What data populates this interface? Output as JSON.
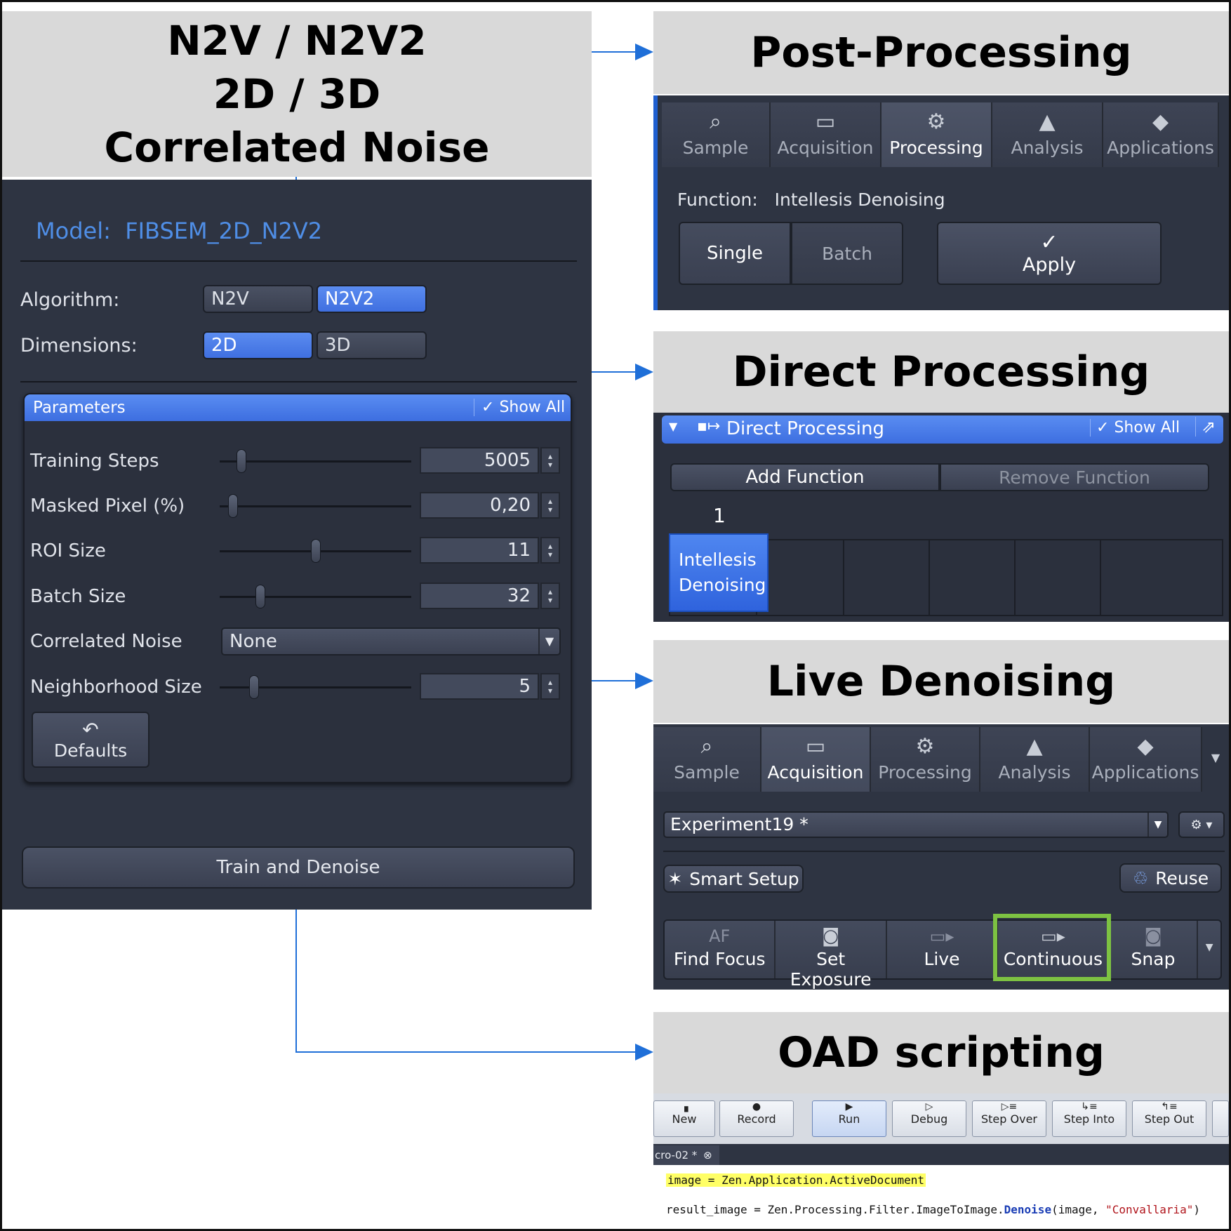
{
  "main_title": {
    "line1": "N2V / N2V2",
    "line2": "2D / 3D",
    "line3": "Correlated Noise"
  },
  "left_panel": {
    "model_label": "Model:",
    "model_value": "FIBSEM_2D_N2V2",
    "algorithm_label": "Algorithm:",
    "algorithm_options": [
      "N2V",
      "N2V2"
    ],
    "algorithm_selected": "N2V2",
    "dimensions_label": "Dimensions:",
    "dimension_options": [
      "2D",
      "3D"
    ],
    "dimension_selected": "2D",
    "parameters_header": "Parameters",
    "show_all": "Show All",
    "params": [
      {
        "label": "Training Steps",
        "value": "5005",
        "slider": 0.1
      },
      {
        "label": "Masked Pixel (%)",
        "value": "0,20",
        "slider": 0.05
      },
      {
        "label": "ROI Size",
        "value": "11",
        "slider": 0.5
      },
      {
        "label": "Batch Size",
        "value": "32",
        "slider": 0.2
      }
    ],
    "correlated_noise_label": "Correlated Noise",
    "correlated_noise_value": "None",
    "neighborhood_label": "Neighborhood Size",
    "neighborhood_value": "5",
    "neighborhood_slider": 0.17,
    "defaults_button": "Defaults",
    "train_button": "Train and Denoise"
  },
  "post_processing": {
    "title": "Post-Processing",
    "tabs": [
      "Sample",
      "Acquisition",
      "Processing",
      "Analysis",
      "Applications"
    ],
    "active_tab": "Processing",
    "function_label": "Function:",
    "function_value": "Intellesis Denoising",
    "single": "Single",
    "batch": "Batch",
    "apply": "Apply"
  },
  "direct_processing": {
    "title": "Direct Processing",
    "header": "Direct Processing",
    "show_all": "Show All",
    "add_function": "Add Function",
    "remove_function": "Remove Function",
    "slot_number": "1",
    "slot_line1": "Intellesis",
    "slot_line2": "Denoising"
  },
  "live_denoising": {
    "title": "Live Denoising",
    "tabs": [
      "Sample",
      "Acquisition",
      "Processing",
      "Analysis",
      "Applications"
    ],
    "active_tab": "Acquisition",
    "experiment": "Experiment19 *",
    "smart_setup": "Smart Setup",
    "reuse": "Reuse",
    "actions": [
      "Find Focus",
      "Set Exposure",
      "Live",
      "Continuous",
      "Snap"
    ],
    "af_label": "AF",
    "highlight_color": "#7dc242"
  },
  "oad_scripting": {
    "title": "OAD scripting",
    "toolbar": [
      "New",
      "Record",
      "Run",
      "Debug",
      "Step Over",
      "Step Into",
      "Step Out"
    ],
    "doc_tab": "cro-02 *",
    "code_line1": "image = Zen.Application.ActiveDocument",
    "code_line2_prefix": "result_image = Zen.Processing.Filter.ImageToImage.",
    "code_line2_method": "Denoise",
    "code_line2_args": "(image, ",
    "code_line2_string": "\"Convallaria\"",
    "code_line2_end": ")"
  },
  "colors": {
    "accent": "#3f6fe0",
    "arrow": "#1f6fd8",
    "dark_bg": "#2e3442",
    "title_bg": "#d9d9d9"
  }
}
